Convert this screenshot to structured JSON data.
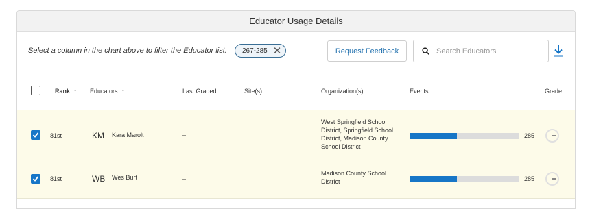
{
  "header": {
    "title": "Educator Usage Details"
  },
  "toolbar": {
    "filter_hint": "Select a column in the chart above to filter the Educator list.",
    "filter_chip": "267-285",
    "feedback_button": "Request Feedback",
    "search_placeholder": "Search Educators",
    "download_icon": "download-icon"
  },
  "columns": {
    "rank": "Rank",
    "rank_sort": "↑",
    "educators": "Educators",
    "educators_sort": "↑",
    "last_graded": "Last Graded",
    "sites": "Site(s)",
    "organizations": "Organization(s)",
    "events": "Events",
    "grade": "Grade"
  },
  "rows": [
    {
      "checked": true,
      "rank": "81st",
      "initials": "KM",
      "name": "Kara Marolt",
      "last_graded": "–",
      "sites": "",
      "organization": "West Springfield School District, Springfield School District, Madison County School District",
      "events": "285",
      "events_fill": 0.43
    },
    {
      "checked": true,
      "rank": "81st",
      "initials": "WB",
      "name": "Wes Burt",
      "last_graded": "–",
      "sites": "",
      "organization": "Madison County School District",
      "events": "285",
      "events_fill": 0.43
    }
  ],
  "colors": {
    "accent": "#1776c7",
    "row_highlight": "#fdfbe9",
    "bar_track": "#dcdcdc"
  }
}
